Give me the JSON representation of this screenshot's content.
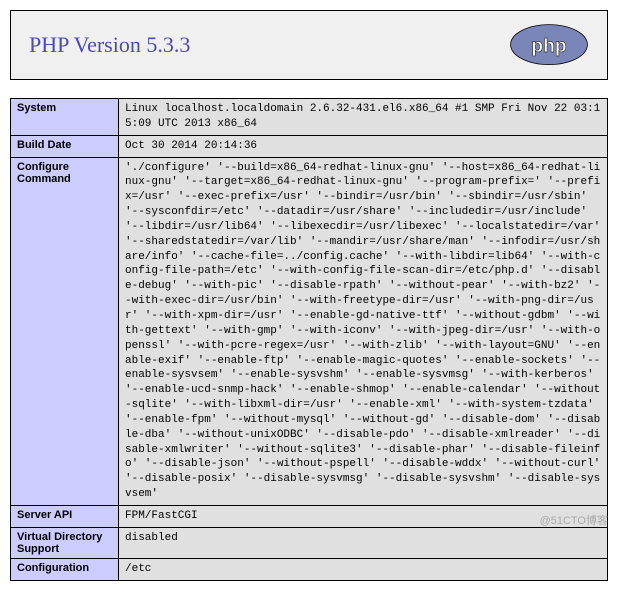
{
  "header": {
    "title": "PHP Version 5.3.3",
    "logo_alt": "php"
  },
  "rows": {
    "system": {
      "label": "System",
      "value": "Linux localhost.localdomain 2.6.32-431.el6.x86_64 #1 SMP Fri Nov 22 03:15:09 UTC 2013 x86_64"
    },
    "build_date": {
      "label": "Build Date",
      "value": "Oct 30 2014 20:14:36"
    },
    "configure": {
      "label": "Configure Command",
      "value": "'./configure' '--build=x86_64-redhat-linux-gnu' '--host=x86_64-redhat-linux-gnu' '--target=x86_64-redhat-linux-gnu' '--program-prefix=' '--prefix=/usr' '--exec-prefix=/usr' '--bindir=/usr/bin' '--sbindir=/usr/sbin' '--sysconfdir=/etc' '--datadir=/usr/share' '--includedir=/usr/include' '--libdir=/usr/lib64' '--libexecdir=/usr/libexec' '--localstatedir=/var' '--sharedstatedir=/var/lib' '--mandir=/usr/share/man' '--infodir=/usr/share/info' '--cache-file=../config.cache' '--with-libdir=lib64' '--with-config-file-path=/etc' '--with-config-file-scan-dir=/etc/php.d' '--disable-debug' '--with-pic' '--disable-rpath' '--without-pear' '--with-bz2' '--with-exec-dir=/usr/bin' '--with-freetype-dir=/usr' '--with-png-dir=/usr' '--with-xpm-dir=/usr' '--enable-gd-native-ttf' '--without-gdbm' '--with-gettext' '--with-gmp' '--with-iconv' '--with-jpeg-dir=/usr' '--with-openssl' '--with-pcre-regex=/usr' '--with-zlib' '--with-layout=GNU' '--enable-exif' '--enable-ftp' '--enable-magic-quotes' '--enable-sockets' '--enable-sysvsem' '--enable-sysvshm' '--enable-sysvmsg' '--with-kerberos' '--enable-ucd-snmp-hack' '--enable-shmop' '--enable-calendar' '--without-sqlite' '--with-libxml-dir=/usr' '--enable-xml' '--with-system-tzdata' '--enable-fpm' '--without-mysql' '--without-gd' '--disable-dom' '--disable-dba' '--without-unixODBC' '--disable-pdo' '--disable-xmlreader' '--disable-xmlwriter' '--without-sqlite3' '--disable-phar' '--disable-fileinfo' '--disable-json' '--without-pspell' '--disable-wddx' '--without-curl' '--disable-posix' '--disable-sysvmsg' '--disable-sysvshm' '--disable-sysvsem'"
    },
    "server_api": {
      "label": "Server API",
      "value": "FPM/FastCGI"
    },
    "virtual_dir": {
      "label": "Virtual Directory Support",
      "value": "disabled"
    },
    "config": {
      "label": "Configuration",
      "value": "/etc"
    }
  },
  "watermark": "@51CTO博客"
}
